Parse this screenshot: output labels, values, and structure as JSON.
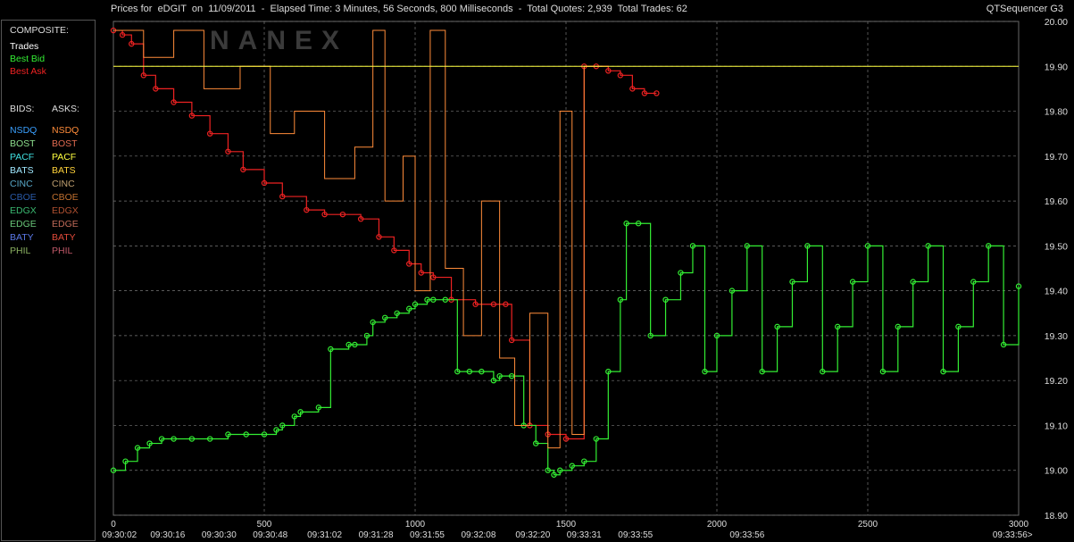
{
  "window": {
    "title": "Prices for  eDGIT  on  11/09/2011  -  Elapsed Time: 3 Minutes, 56 Seconds, 800 Milliseconds  -  Total Quotes: 2,939  Total Trades: 62",
    "brand": "QTSequencer G3"
  },
  "legend": {
    "composite_header": "COMPOSITE:",
    "composite": [
      {
        "label": "Trades",
        "color": "#ffffff"
      },
      {
        "label": "Best Bid",
        "color": "#33ee33"
      },
      {
        "label": "Best Ask",
        "color": "#ee2222"
      }
    ],
    "bids_header": "BIDS:",
    "asks_header": "ASKS:",
    "exchanges": [
      {
        "bid": "NSDQ",
        "bid_color": "#3aa0ff",
        "ask": "NSDQ",
        "ask_color": "#ff8c3a"
      },
      {
        "bid": "BOST",
        "bid_color": "#8ee08e",
        "ask": "BOST",
        "ask_color": "#e06a50"
      },
      {
        "bid": "PACF",
        "bid_color": "#40e0e0",
        "ask": "PACF",
        "ask_color": "#ffff40"
      },
      {
        "bid": "BATS",
        "bid_color": "#a0e8ff",
        "ask": "BATS",
        "ask_color": "#ffd23a"
      },
      {
        "bid": "CINC",
        "bid_color": "#58a8c8",
        "ask": "CINC",
        "ask_color": "#c0a070"
      },
      {
        "bid": "CBOE",
        "bid_color": "#2a5aa8",
        "ask": "CBOE",
        "ask_color": "#c07030"
      },
      {
        "bid": "EDGX",
        "bid_color": "#3ab870",
        "ask": "EDGX",
        "ask_color": "#b05030"
      },
      {
        "bid": "EDGE",
        "bid_color": "#6ac87a",
        "ask": "EDGE",
        "ask_color": "#c06a58"
      },
      {
        "bid": "BATY",
        "bid_color": "#5a78e8",
        "ask": "BATY",
        "ask_color": "#e04a3a"
      },
      {
        "bid": "PHIL",
        "bid_color": "#8ab060",
        "ask": "PHIL",
        "ask_color": "#c05868"
      }
    ]
  },
  "chart_data": {
    "type": "line",
    "watermark": "NANEX",
    "ylim": [
      18.9,
      20.0
    ],
    "y_ticks": [
      "20.00",
      "19.90",
      "19.80",
      "19.70",
      "19.60",
      "19.50",
      "19.40",
      "19.30",
      "19.20",
      "19.10",
      "19.00",
      "18.90"
    ],
    "xlim": [
      0,
      3000
    ],
    "x_ticks": [
      "0",
      "500",
      "1000",
      "1500",
      "2000",
      "2500",
      "3000"
    ],
    "time_labels": [
      {
        "x": 20,
        "t": "09:30:02"
      },
      {
        "x": 180,
        "t": "09:30:16"
      },
      {
        "x": 350,
        "t": "09:30:30"
      },
      {
        "x": 520,
        "t": "09:30:48"
      },
      {
        "x": 700,
        "t": "09:31:02"
      },
      {
        "x": 870,
        "t": "09:31:28"
      },
      {
        "x": 1040,
        "t": "09:31:55"
      },
      {
        "x": 1210,
        "t": "09:32:08"
      },
      {
        "x": 1390,
        "t": "09:32:20"
      },
      {
        "x": 1560,
        "t": "09:33:31"
      },
      {
        "x": 1730,
        "t": "09:33:55"
      },
      {
        "x": 2100,
        "t": "09:33:56"
      },
      {
        "x": 2980,
        "t": "09:33:56>"
      }
    ],
    "series": [
      {
        "role": "best_ask",
        "color": "#ee2222",
        "x": [
          0,
          30,
          60,
          100,
          140,
          200,
          260,
          320,
          380,
          430,
          500,
          560,
          640,
          700,
          760,
          820,
          880,
          930,
          980,
          1020,
          1060,
          1120,
          1200,
          1260,
          1300,
          1320,
          1380,
          1440,
          1500,
          1560,
          1600,
          1640,
          1680,
          1720,
          1760,
          1800
        ],
        "y": [
          19.98,
          19.97,
          19.95,
          19.88,
          19.85,
          19.82,
          19.79,
          19.75,
          19.71,
          19.67,
          19.64,
          19.61,
          19.58,
          19.57,
          19.57,
          19.56,
          19.52,
          19.49,
          19.46,
          19.44,
          19.43,
          19.38,
          19.37,
          19.37,
          19.37,
          19.29,
          19.1,
          19.08,
          19.07,
          19.9,
          19.9,
          19.89,
          19.88,
          19.85,
          19.84,
          19.84
        ]
      },
      {
        "role": "best_bid",
        "color": "#33ee33",
        "x": [
          0,
          40,
          80,
          120,
          160,
          200,
          260,
          320,
          380,
          440,
          500,
          540,
          560,
          600,
          620,
          680,
          720,
          780,
          800,
          840,
          860,
          900,
          940,
          980,
          1000,
          1040,
          1060,
          1100,
          1140,
          1180,
          1220,
          1260,
          1280,
          1320,
          1360,
          1400,
          1440,
          1460,
          1480,
          1520,
          1560,
          1600,
          1640,
          1680,
          1700,
          1740,
          1780,
          1830,
          1880,
          1920,
          1960,
          2000,
          2050,
          2100,
          2150,
          2200,
          2250,
          2300,
          2350,
          2400,
          2450,
          2500,
          2550,
          2600,
          2650,
          2700,
          2750,
          2800,
          2850,
          2900,
          2950,
          3000
        ],
        "y": [
          19.0,
          19.02,
          19.05,
          19.06,
          19.07,
          19.07,
          19.07,
          19.07,
          19.08,
          19.08,
          19.08,
          19.09,
          19.1,
          19.12,
          19.13,
          19.14,
          19.27,
          19.28,
          19.28,
          19.3,
          19.33,
          19.34,
          19.35,
          19.36,
          19.37,
          19.38,
          19.38,
          19.38,
          19.22,
          19.22,
          19.22,
          19.2,
          19.21,
          19.21,
          19.1,
          19.06,
          19.0,
          18.99,
          19.0,
          19.01,
          19.02,
          19.07,
          19.22,
          19.38,
          19.55,
          19.55,
          19.3,
          19.38,
          19.44,
          19.5,
          19.22,
          19.3,
          19.4,
          19.5,
          19.22,
          19.32,
          19.42,
          19.5,
          19.22,
          19.32,
          19.42,
          19.5,
          19.22,
          19.32,
          19.42,
          19.5,
          19.22,
          19.32,
          19.42,
          19.5,
          19.28,
          19.41
        ]
      },
      {
        "role": "nsdq_ask",
        "color": "#ff8c3a",
        "x": [
          0,
          100,
          200,
          300,
          420,
          520,
          600,
          700,
          800,
          860,
          900,
          960,
          1000,
          1050,
          1100,
          1160,
          1220,
          1280,
          1330,
          1380,
          1440,
          1480,
          1520,
          1560,
          1620
        ],
        "y": [
          19.98,
          19.92,
          19.98,
          19.85,
          19.9,
          19.75,
          19.8,
          19.65,
          19.72,
          19.98,
          19.6,
          19.7,
          19.4,
          19.98,
          19.45,
          19.3,
          19.6,
          19.25,
          19.1,
          19.35,
          19.05,
          19.8,
          19.08,
          19.9,
          19.9
        ]
      },
      {
        "role": "pacf_ask",
        "color": "#ffff40",
        "x": [
          0,
          2000,
          3000
        ],
        "y": [
          19.9,
          19.9,
          19.9
        ]
      }
    ]
  }
}
